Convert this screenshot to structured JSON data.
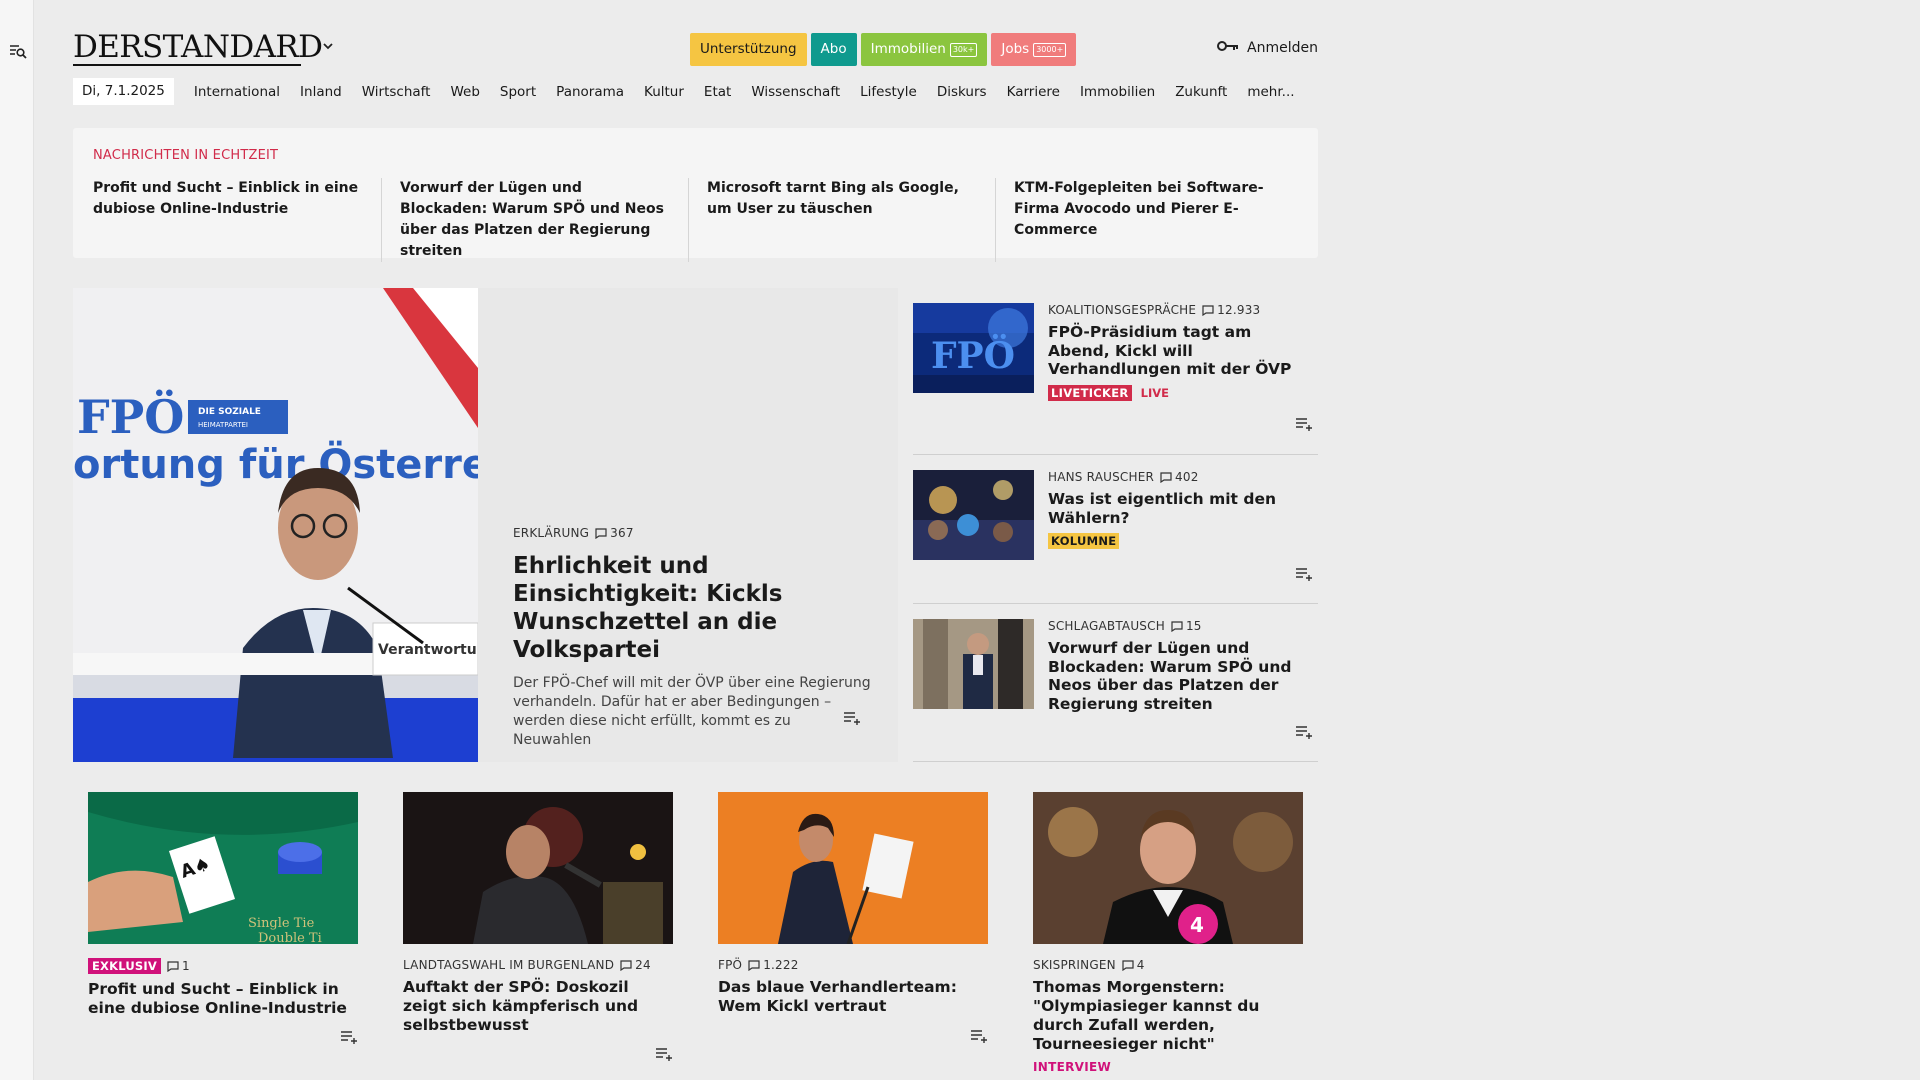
{
  "header": {
    "logo": "DERSTANDARD",
    "buttons": [
      {
        "label": "Unterstützung",
        "color": "#f5c542"
      },
      {
        "label": "Abo",
        "color": "#0f9a8e"
      },
      {
        "label": "Immobilien",
        "tag": "30k+",
        "color": "#8bc53f"
      },
      {
        "label": "Jobs",
        "tag": "3000+",
        "color": "#f07c7c"
      }
    ],
    "login": "Anmelden"
  },
  "nav": {
    "date": "Di, 7.1.2025",
    "items": [
      "International",
      "Inland",
      "Wirtschaft",
      "Web",
      "Sport",
      "Panorama",
      "Kultur",
      "Etat",
      "Wissenschaft",
      "Lifestyle",
      "Diskurs",
      "Karriere",
      "Immobilien",
      "Zukunft",
      "mehr..."
    ]
  },
  "realtime": {
    "label": "NACHRICHTEN IN ECHTZEIT",
    "items": [
      "Profit und Sucht – Einblick in eine dubiose Online-Industrie",
      "Vorwurf der Lügen und Blockaden: Warum SPÖ und Neos über das Platzen der Regierung streiten",
      "Microsoft tarnt Bing als Google, um User zu täuschen",
      "KTM-Folgepleiten bei Software-Firma Avocodo und Pierer E-Commerce"
    ]
  },
  "hero": {
    "kicker": "ERKLÄRUNG",
    "comments": "367",
    "title": "Ehrlichkeit und Einsichtigkeit: Kickls Wunschzettel an die Volkspartei",
    "lead": "Der FPÖ-Chef will mit der ÖVP über eine Regierung verhandeln. Dafür hat er aber Bedingungen – werden diese nicht erfüllt, kommt es zu Neuwahlen",
    "image_text": [
      "FPÖ",
      "DIE SOZIALE",
      "HEIMATPARTEI",
      "ortung für Österreich",
      "Verantwortu"
    ]
  },
  "side": [
    {
      "kicker": "KOALITIONSGESPRÄCHE",
      "comments": "12.933",
      "title": "FPÖ-Präsidium tagt am Abend, Kickl will Verhandlungen mit der ÖVP",
      "badge": "LIVETICKER",
      "badge_color": "#d12b4a",
      "live": "LIVE",
      "image_text": "FPÖ"
    },
    {
      "kicker": "HANS RAUSCHER",
      "comments": "402",
      "title": "Was ist eigentlich mit den Wählern?",
      "badge": "KOLUMNE",
      "badge_color": "#f5c542"
    },
    {
      "kicker": "SCHLAGABTAUSCH",
      "comments": "15",
      "title": "Vorwurf der Lügen und Blockaden: Warum SPÖ und Neos über das Platzen der Regierung streiten"
    }
  ],
  "cards": [
    {
      "badge": "EXKLUSIV",
      "kicker": "",
      "comments": "1",
      "title": "Profit und Sucht – Einblick in eine dubiose Online-Industrie",
      "image_text": [
        "Single Tie",
        "Double Ti"
      ]
    },
    {
      "kicker": "LANDTAGSWAHL IM BURGENLAND",
      "comments": "24",
      "title": "Auftakt der SPÖ: Doskozil zeigt sich kämpferisch und selbstbewusst"
    },
    {
      "kicker": "FPÖ",
      "comments": "1.222",
      "title": "Das blaue Verhandlerteam: Wem Kickl vertraut"
    },
    {
      "kicker": "SKISPRINGEN",
      "comments": "4",
      "title": "Thomas Morgenstern: \"Olympiasieger kannst du durch Zufall werden, Tourneesieger nicht\"",
      "tag": "INTERVIEW",
      "image_text": "4"
    }
  ]
}
